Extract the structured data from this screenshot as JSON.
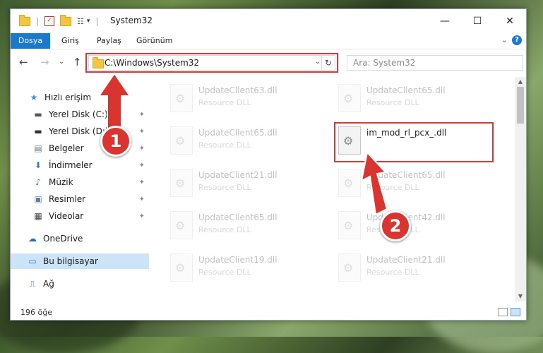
{
  "window": {
    "title": "System32",
    "controls": {
      "minimize": "—",
      "maximize": "☐",
      "close": "✕"
    }
  },
  "ribbon": {
    "tabs": [
      {
        "label": "Dosya",
        "active": true
      },
      {
        "label": "Giriş",
        "active": false
      },
      {
        "label": "Paylaş",
        "active": false
      },
      {
        "label": "Görünüm",
        "active": false
      }
    ],
    "expand": "⌄",
    "help": "?"
  },
  "nav": {
    "back": "←",
    "forward": "→",
    "recent": "⌄",
    "up": "↑",
    "address": "C:\\Windows\\System32",
    "address_dropdown": "⌄",
    "refresh": "↻",
    "search_placeholder": "Ara: System32"
  },
  "sidebar": {
    "items": [
      {
        "label": "Hızlı erişim",
        "icon": "star-icon",
        "glyph": "★",
        "color": "#3b8fd6",
        "pinned": false
      },
      {
        "label": "Yerel Disk (C:)",
        "icon": "drive-icon",
        "glyph": "▬",
        "color": "#555555",
        "pinned": true
      },
      {
        "label": "Yerel Disk (D:)",
        "icon": "drive-icon",
        "glyph": "▬",
        "color": "#333333",
        "pinned": true
      },
      {
        "label": "Belgeler",
        "icon": "documents-icon",
        "glyph": "▤",
        "color": "#6e7b8b",
        "pinned": true
      },
      {
        "label": "İndirmeler",
        "icon": "download-icon",
        "glyph": "⬇",
        "color": "#2f7fd0",
        "pinned": true
      },
      {
        "label": "Müzik",
        "icon": "music-icon",
        "glyph": "♪",
        "color": "#2f7fd0",
        "pinned": true
      },
      {
        "label": "Resimler",
        "icon": "pictures-icon",
        "glyph": "▣",
        "color": "#5a7fa8",
        "pinned": true
      },
      {
        "label": "Videolar",
        "icon": "video-icon",
        "glyph": "▦",
        "color": "#444444",
        "pinned": true
      },
      {
        "label": "OneDrive",
        "icon": "cloud-icon",
        "glyph": "☁",
        "color": "#1d6fd0",
        "pinned": false
      },
      {
        "label": "Bu bilgisayar",
        "icon": "computer-icon",
        "glyph": "▭",
        "color": "#2f7fd0",
        "pinned": false,
        "selected": true
      },
      {
        "label": "Ağ",
        "icon": "network-icon",
        "glyph": "⎍",
        "color": "#2f7fd0",
        "pinned": false
      }
    ],
    "pin_glyph": "📌"
  },
  "files": [
    {
      "name": "UpdateClient63.dll",
      "type": "Resource DLL"
    },
    {
      "name": "UpdateClient65.dll",
      "type": "Resource DLL"
    },
    {
      "name": "UpdateClient65.dll",
      "type": "Resource DLL"
    },
    {
      "name": "im_mod_rl_pcx_.dll",
      "type": "",
      "highlighted": true
    },
    {
      "name": "UpdateClient21.dll",
      "type": "Resource DLL"
    },
    {
      "name": "UpdateClient65.dll",
      "type": "Resource DLL"
    },
    {
      "name": "UpdateClient65.dll",
      "type": "Resource DLL"
    },
    {
      "name": "UpdateClient42.dll",
      "type": "Resource DLL"
    },
    {
      "name": "UpdateClient19.dll",
      "type": "Resource DLL"
    },
    {
      "name": "UpdateClient21.dll",
      "type": "Resource DLL"
    }
  ],
  "status": {
    "item_count": "196 öğe"
  },
  "annotations": {
    "step1": "1",
    "step2": "2",
    "color": "#d9342f"
  }
}
